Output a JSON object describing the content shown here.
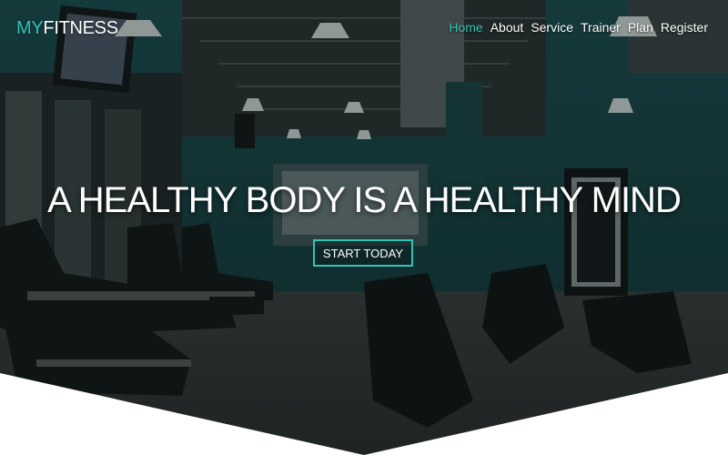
{
  "navbar": {
    "brand": {
      "accent": "MY",
      "rest": "FITNESS"
    },
    "links": [
      {
        "label": "Home",
        "active": true
      },
      {
        "label": "About",
        "active": false
      },
      {
        "label": "Service",
        "active": false
      },
      {
        "label": "Trainer",
        "active": false
      },
      {
        "label": "Plan",
        "active": false
      },
      {
        "label": "Register",
        "active": false
      }
    ]
  },
  "hero": {
    "headline": "A HEALTHY BODY IS A HEALTHY MIND",
    "cta_label": "START TODAY"
  },
  "colors": {
    "accent": "#2ec4b6",
    "wall_teal": "#1f5a5c",
    "overlay": "#0b1414",
    "white": "#ffffff"
  }
}
